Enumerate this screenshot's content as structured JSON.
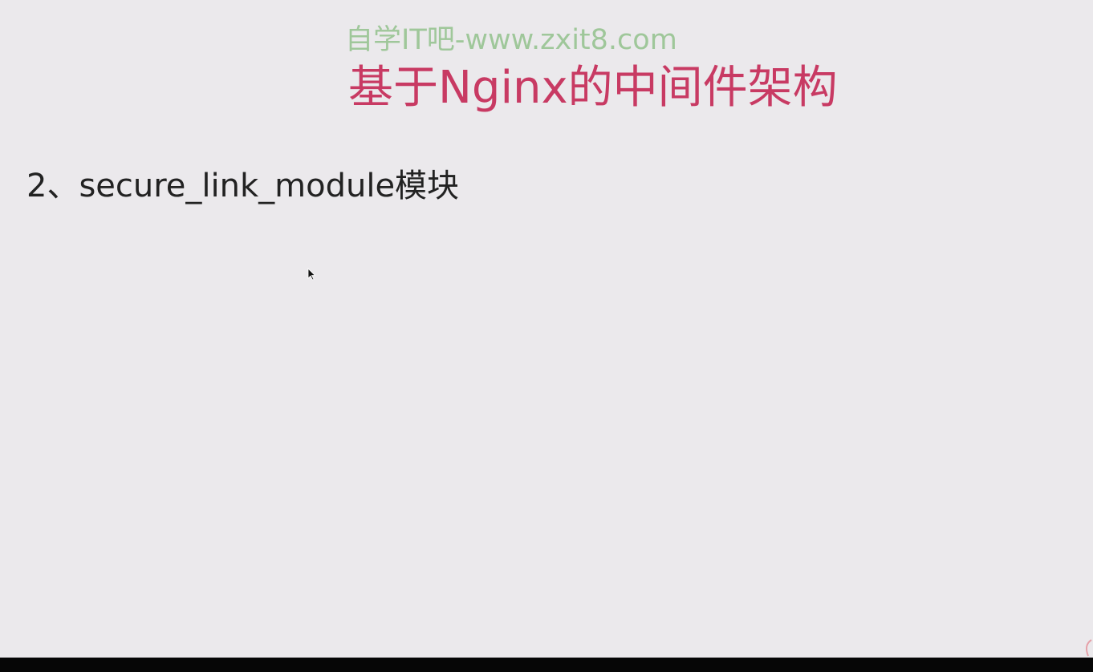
{
  "slide": {
    "watermark": "自学IT吧-www.zxit8.com",
    "title": "基于Nginx的中间件架构",
    "section_heading": "2、secure_link_module模块"
  },
  "colors": {
    "background": "#ebe9ec",
    "watermark": "#9fc79a",
    "title": "#c83a63",
    "text": "#222222",
    "bottom_bar": "#060606"
  },
  "icons": {
    "cursor": "mouse-pointer-icon",
    "corner": "corner-logo-icon"
  }
}
